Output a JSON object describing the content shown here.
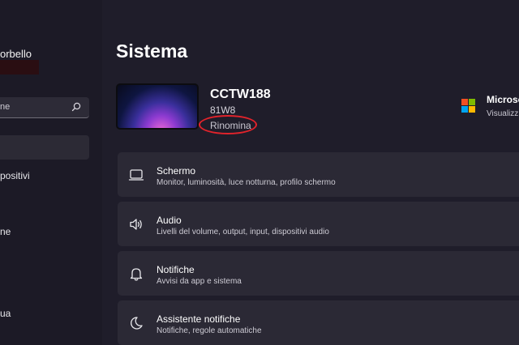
{
  "sidebar": {
    "user_name": "orbello",
    "search_text": "ne",
    "items": [
      {
        "label": "positivi"
      },
      {
        "label": "ne"
      },
      {
        "label": "ua"
      }
    ]
  },
  "main": {
    "title": "Sistema",
    "device": {
      "name": "CCTW188",
      "model": "81W8",
      "rename_label": "Rinomina"
    },
    "microsoft": {
      "title": "Microso",
      "subtitle": "Visualizz"
    },
    "settings": [
      {
        "title": "Schermo",
        "description": "Monitor, luminosità, luce notturna, profilo schermo",
        "icon": "monitor-icon"
      },
      {
        "title": "Audio",
        "description": "Livelli del volume, output, input, dispositivi audio",
        "icon": "speaker-icon"
      },
      {
        "title": "Notifiche",
        "description": "Avvisi da app e sistema",
        "icon": "bell-icon"
      },
      {
        "title": "Assistente notifiche",
        "description": "Notifiche, regole automatiche",
        "icon": "moon-icon"
      }
    ]
  },
  "colors": {
    "background": "#1f1d2a",
    "card": "#2b2935",
    "annotation": "#e2232b"
  }
}
